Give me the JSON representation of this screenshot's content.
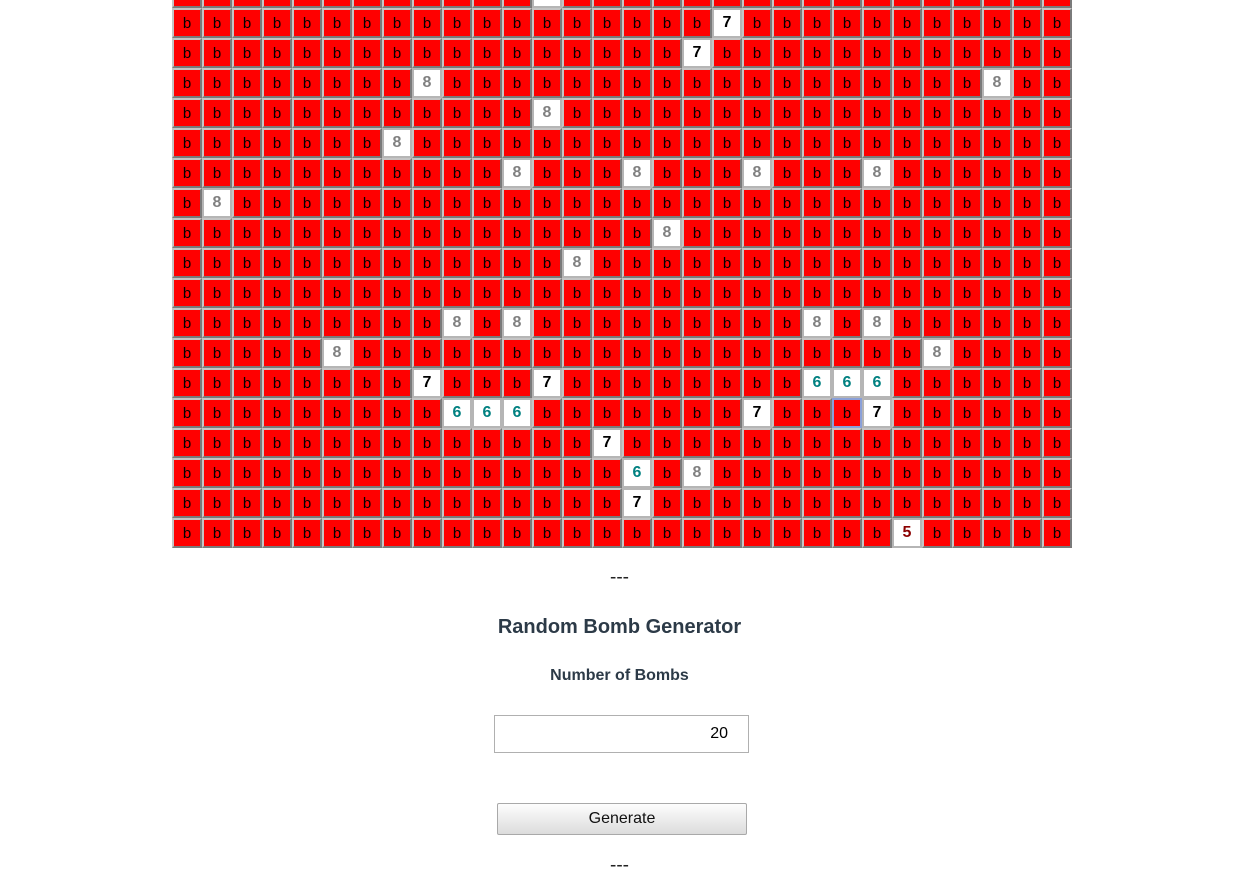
{
  "board": {
    "columns": 30,
    "bomb_label": "b",
    "first_row_partial": true,
    "rows": [
      "bbbbbbbbbbbbbbbbbbbbbbbbbbbbbb",
      "bbbbbbbbbbbbbbbbbb7bbbbbbbbbbb",
      "bbbbbbbbbbbbbbbbb7bbbbbbbbbbbb",
      "bbbbbbbb8bbbbbbbbbbbbbbbbbb8bb",
      "bbbbbbbbbbbb8bbbbbbbbbbbbbbbbb",
      "bbbbbbb8bbbbbbbbbbbbbbbbbbbbbb",
      "bbbbbbbbbbb8bbb8bbb8bbb8bbbbbbb",
      "b8bbbbbbbbbbbbbbbbbbbbbbbbbbbb",
      "bbbbbbbbbbbbbbbb8bbbbbbbbbbbbb",
      "bbbbbbbbbbbbb8bbbbbbbbbbbbbbbb",
      "bbbbbbbbbbbbbbbbbbbbbbbbbbbbbb",
      "bbbbbbbbb8b8bbbbbbbbb8b8bbbbbb",
      "bbbbb8bbbbbbbbbbbbbbbbbbb8bbbb",
      "bbbbbbbb7bbb7bbbbbbbb666bbbbbb",
      "bbbbbbbbb666bbbbbbb7bbb7bbbbbb",
      "bbbbbbbbbbbbbb7bbbbbbbbbbbbbbb",
      "bbbbbbbbbbbbbbb6b8bbbbbbbbbbbb",
      "bbbbbbbbbbbbbbb7bbbbbbbbbbbbbb",
      "bbbbbbbbbbbbbbbbbbbbbbbb5bbbbb"
    ],
    "top_partial_open_column": 12,
    "number_colors": {
      "5": "#8b0000",
      "6": "#008080",
      "7": "#000000",
      "8": "#808080"
    },
    "focused_cell": {
      "row": 14,
      "col": 22
    }
  },
  "separator_top": "---",
  "generator": {
    "title": "Random Bomb Generator",
    "count_label": "Number of Bombs",
    "count_value": "20",
    "generate_label": "Generate"
  },
  "separator_bottom": "---"
}
